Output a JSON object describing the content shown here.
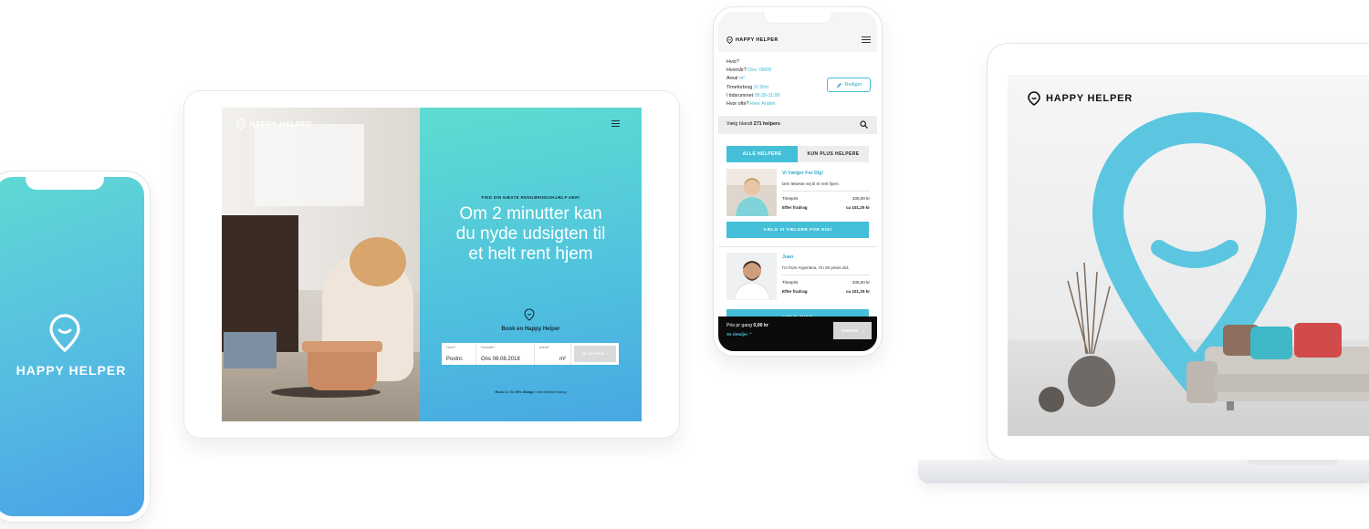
{
  "brand": {
    "name": "HAPPY HELPER",
    "accent_color": "#45bfd8",
    "gradient_start": "#5fdcd1",
    "gradient_end": "#47a8e2"
  },
  "phone_splash": {
    "brand_label": "HAPPY HELPER",
    "icon": "location-pin-smile-icon"
  },
  "tablet": {
    "logo_text": "HAPPY HELPER",
    "eyebrow": "FIND DIN NÆSTE RENGØRINGSHJÆLP HER!",
    "headline_lines": [
      "Om 2 minutter kan",
      "du nyde udsigten til",
      "et helt rent hjem"
    ],
    "book_label": "Book en Happy Helper",
    "form": {
      "where_label": "Hvor?",
      "where_value": "Postnr.",
      "when_label": "Hvornår?",
      "when_value": "Ons 08.08.2018",
      "area_label": "Areal?",
      "area_value": "m²",
      "submit_label": "SE DIN PRIS"
    },
    "footnote_bold": "Husk",
    "footnote_mid": " Du får ",
    "footnote_pct": "25% tilbage",
    "footnote_end": " i håndværkerfradrag"
  },
  "booking_phone": {
    "logo_text": "HAPPY HELPER",
    "info": {
      "where_label": "Hvor?",
      "when_label": "Hvornår?",
      "when_value": "Ons. 08/08",
      "area_label": "Areal",
      "area_value": "m²",
      "time_label": "Timeforbrug",
      "time_value": "2t 30m",
      "window_label": "I tidsrummet",
      "window_value": "08:30-11:00",
      "freq_label": "Hvor ofte?",
      "freq_value": "Hver Anden"
    },
    "edit_label": "Rediger",
    "search_prefix": "Vælg blandt ",
    "search_count": "271 helpers",
    "tabs": [
      {
        "label": "ALLE HELPERE",
        "active": true
      },
      {
        "label": "KUN PLUS HELPERE",
        "active": false
      }
    ],
    "helpers": [
      {
        "name": "Vi Vælger For Dig!",
        "description": "Den letteste vej til et rent hjem",
        "rate_label": "Timepris",
        "rate_value": "335,00 kr",
        "after_label": "Efter fradrag",
        "after_value": "ca 101,25 kr",
        "cta": "VÆLG VI VÆLGER FOR DIG!"
      },
      {
        "name": "Juan",
        "description": "I'm from Argentina, I'm 28 years old,",
        "rate_label": "Timepris",
        "rate_value": "335,00 kr",
        "after_label": "Efter fradrag",
        "after_value": "ca 101,25 kr",
        "cta": "VÆLG JUAN"
      }
    ],
    "bottom": {
      "price_label": "Pris pr gang ",
      "price_value": "0,00 kr",
      "details_label": "Se detaljer",
      "next_label": "VIDERE"
    }
  },
  "laptop": {
    "logo_text": "HAPPY HELPER"
  }
}
